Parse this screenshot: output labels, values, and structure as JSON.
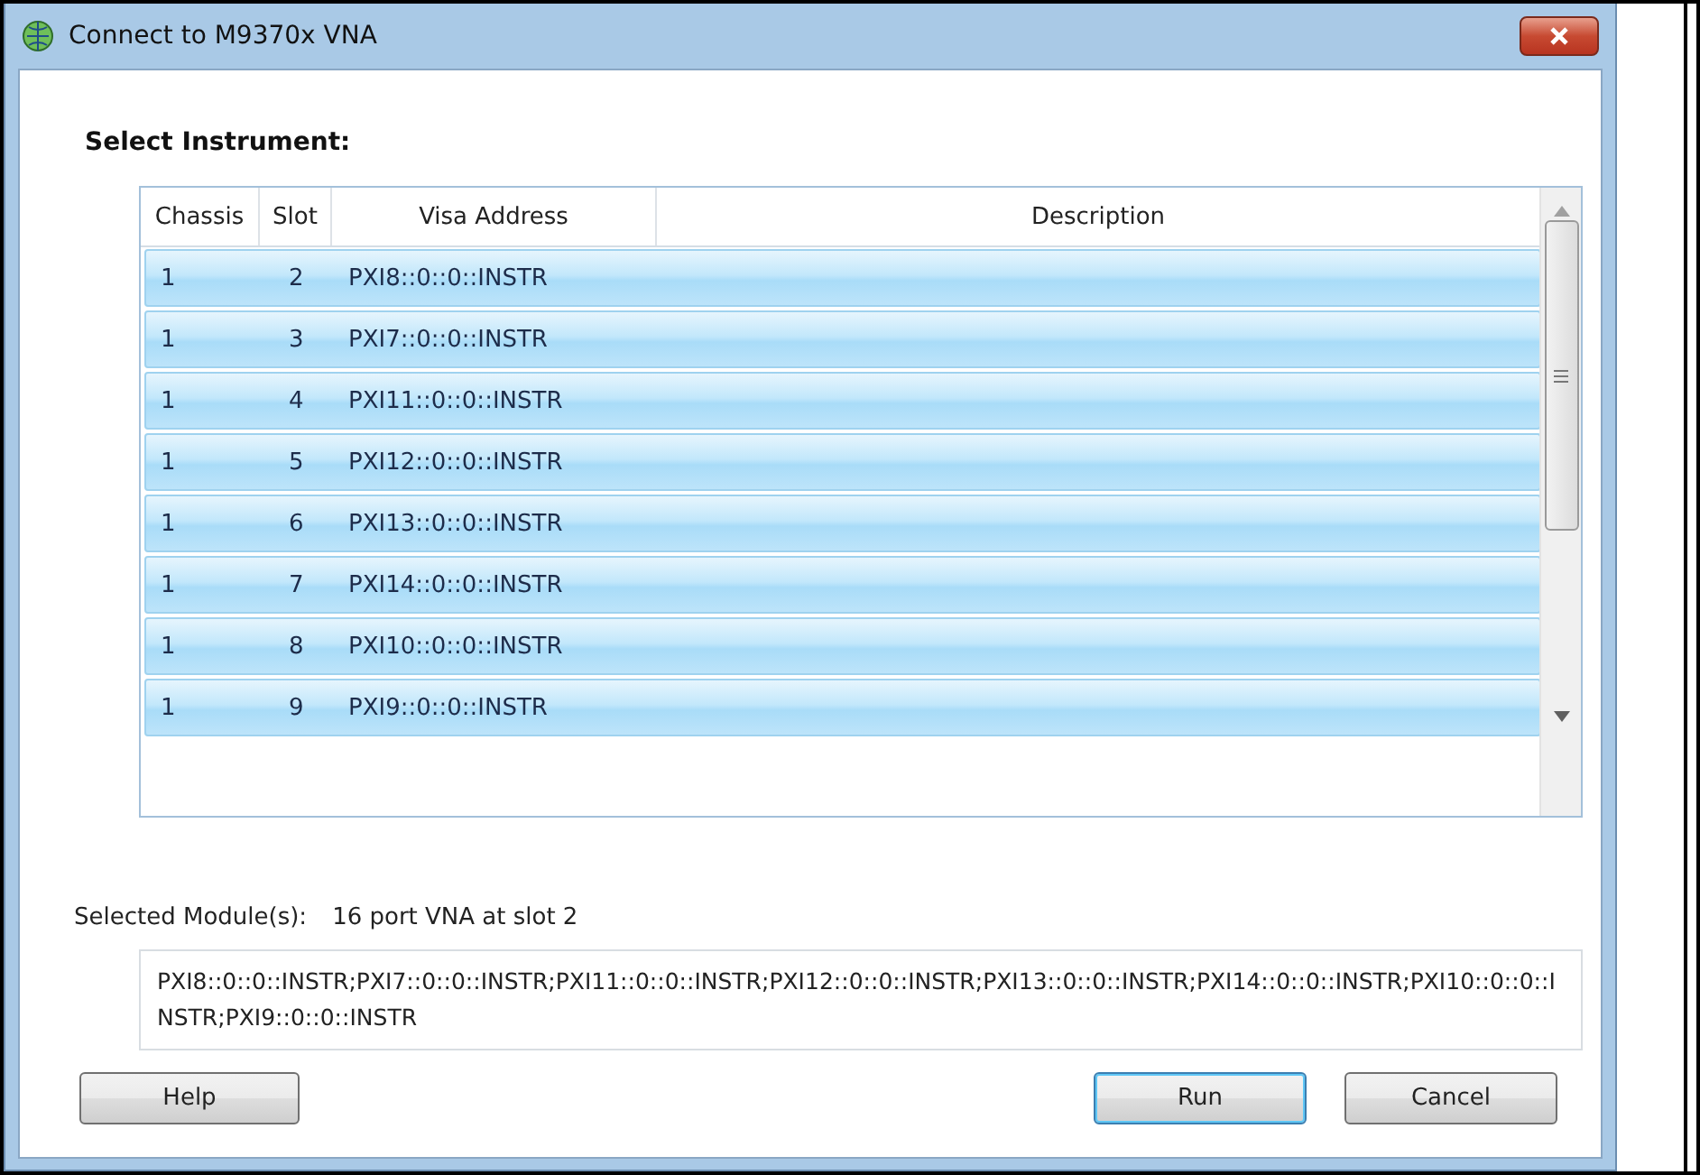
{
  "window": {
    "title": "Connect to M9370x VNA"
  },
  "heading": "Select Instrument:",
  "table": {
    "columns": [
      "Chassis",
      "Slot",
      "Visa Address",
      "Description"
    ],
    "rows": [
      {
        "chassis": "1",
        "slot": "2",
        "address": "PXI8::0::0::INSTR",
        "selected": true
      },
      {
        "chassis": "1",
        "slot": "3",
        "address": "PXI7::0::0::INSTR",
        "selected": true
      },
      {
        "chassis": "1",
        "slot": "4",
        "address": "PXI11::0::0::INSTR",
        "selected": true
      },
      {
        "chassis": "1",
        "slot": "5",
        "address": "PXI12::0::0::INSTR",
        "selected": true
      },
      {
        "chassis": "1",
        "slot": "6",
        "address": "PXI13::0::0::INSTR",
        "selected": true
      },
      {
        "chassis": "1",
        "slot": "7",
        "address": "PXI14::0::0::INSTR",
        "selected": true
      },
      {
        "chassis": "1",
        "slot": "8",
        "address": "PXI10::0::0::INSTR",
        "selected": true
      },
      {
        "chassis": "1",
        "slot": "9",
        "address": "PXI9::0::0::INSTR",
        "selected": true
      }
    ]
  },
  "selected_modules": {
    "label": "Selected Module(s):",
    "value": "16 port VNA at slot 2"
  },
  "addresses": "PXI8::0::0::INSTR;PXI7::0::0::INSTR;PXI11::0::0::INSTR;PXI12::0::0::INSTR;PXI13::0::0::INSTR;PXI14::0::0::INSTR;PXI10::0::0::INSTR;PXI9::0::0::INSTR",
  "buttons": [
    {
      "label": "Help",
      "kind": "left",
      "default": false
    },
    {
      "label": "Run",
      "kind": "right",
      "default": true
    },
    {
      "label": "Cancel",
      "kind": "right",
      "default": false
    }
  ]
}
